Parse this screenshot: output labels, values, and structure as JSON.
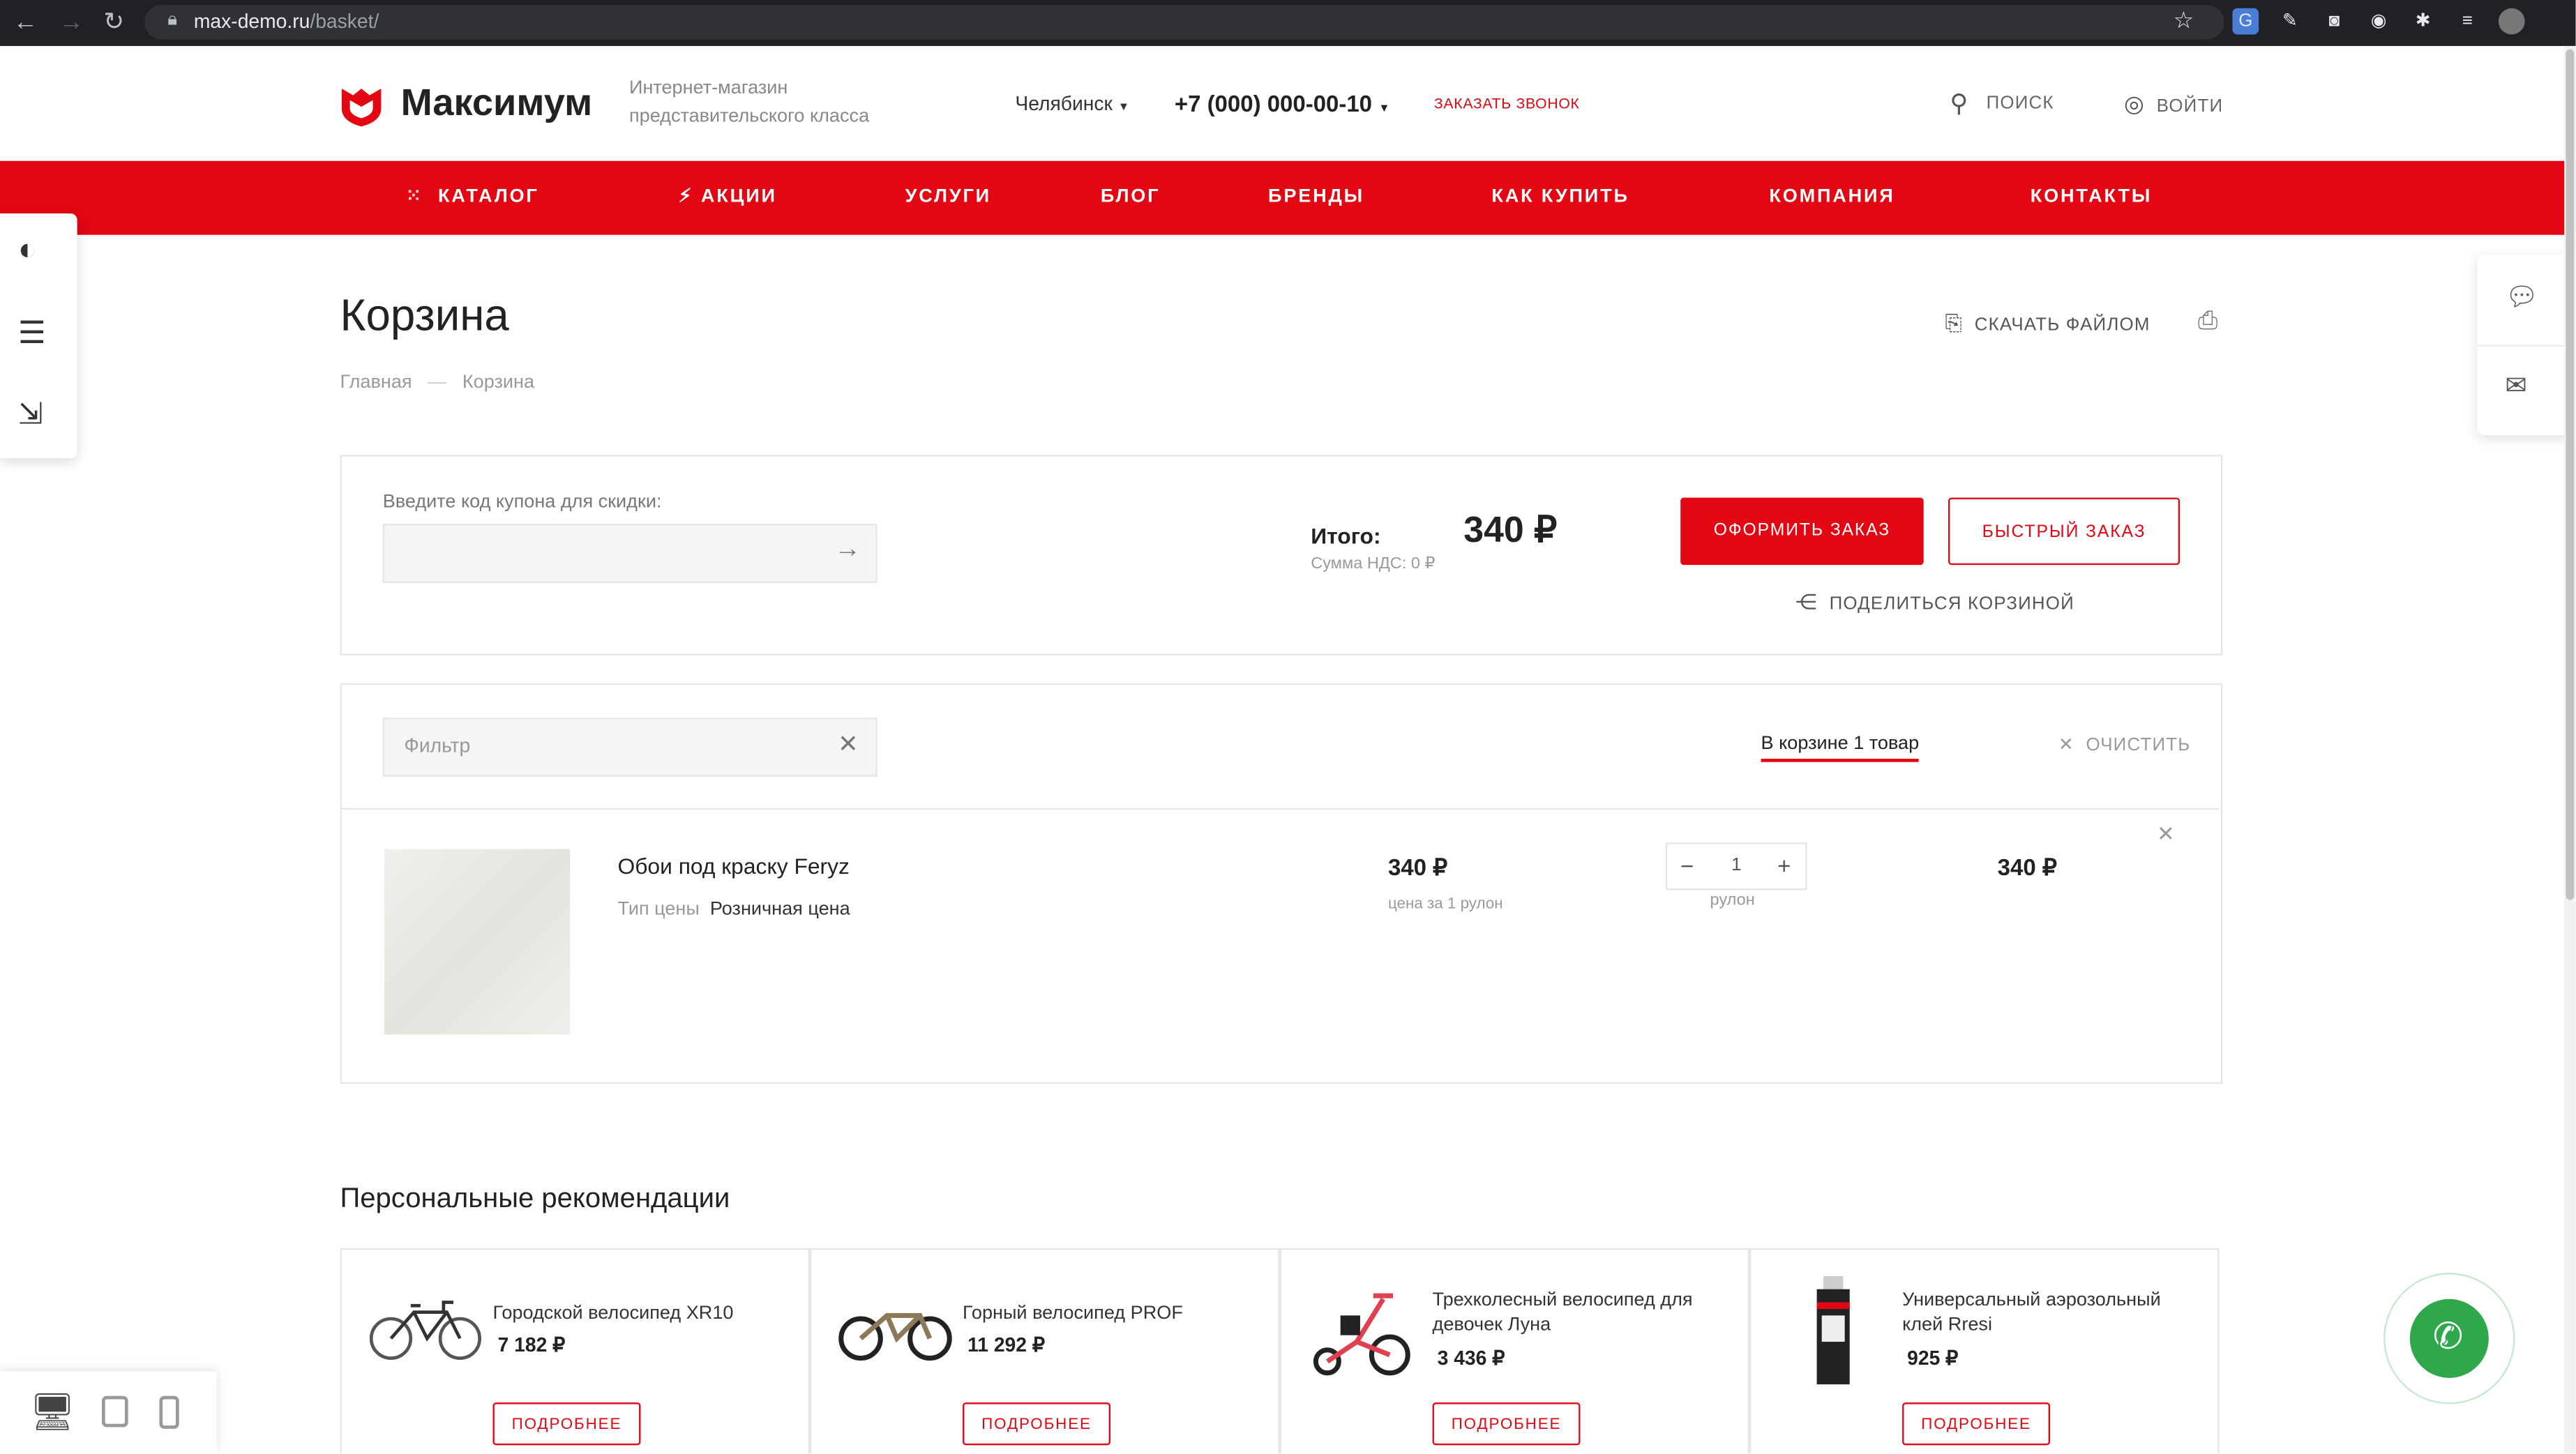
{
  "browser": {
    "url_host": "max-demo.ru",
    "url_path": "/basket/"
  },
  "header": {
    "logo_text": "Максимум",
    "tagline_1": "Интернет-магазин",
    "tagline_2": "представительского класса",
    "city": "Челябинск",
    "phone": "+7 (000) 000-00-10",
    "callback": "ЗАКАЗАТЬ ЗВОНОК",
    "search": "ПОИСК",
    "login": "ВОЙТИ"
  },
  "menu": {
    "catalog": "КАТАЛОГ",
    "promo": "АКЦИИ",
    "services": "УСЛУГИ",
    "blog": "БЛОГ",
    "brands": "БРЕНДЫ",
    "how_to_buy": "КАК КУПИТЬ",
    "company": "КОМПАНИЯ",
    "contacts": "КОНТАКТЫ"
  },
  "page": {
    "title": "Корзина",
    "crumb_home": "Главная",
    "crumb_sep": "—",
    "crumb_current": "Корзина",
    "download": "СКАЧАТЬ ФАЙЛОМ"
  },
  "summary": {
    "coupon_label": "Введите код купона для скидки:",
    "total_label": "Итого:",
    "total_value": "340 ₽",
    "vat": "Сумма НДС: 0 ₽",
    "order_button": "ОФОРМИТЬ ЗАКАЗ",
    "quick_button": "БЫСТРЫЙ ЗАКАЗ",
    "share": "ПОДЕЛИТЬСЯ КОРЗИНОЙ"
  },
  "basket": {
    "filter_placeholder": "Фильтр",
    "count_text": "В корзине 1 товар",
    "clear": "ОЧИСТИТЬ",
    "item": {
      "name": "Обои под краску Feryz",
      "price_type_label": "Тип цены",
      "price_type_value": "Розничная цена",
      "price": "340 ₽",
      "per_unit": "цена за 1 рулон",
      "quantity": "1",
      "unit": "рулон",
      "sum": "340 ₽"
    }
  },
  "recommendations": {
    "title": "Персональные рекомендации",
    "more": "ПОДРОБНЕЕ",
    "items": [
      {
        "name_1": "Городской велосипед XR10",
        "name_2": "",
        "price": "7 182 ₽"
      },
      {
        "name_1": "Горный велосипед PROF",
        "name_2": "",
        "price": "11 292 ₽"
      },
      {
        "name_1": "Трехколесный велосипед для",
        "name_2": "девочек Луна",
        "price": "3 436 ₽"
      },
      {
        "name_1": "Универсальный аэрозольный",
        "name_2": "клей Rresi",
        "price": "925 ₽"
      }
    ]
  },
  "colors": {
    "accent": "#e30613",
    "call_green": "#2ea84a"
  }
}
